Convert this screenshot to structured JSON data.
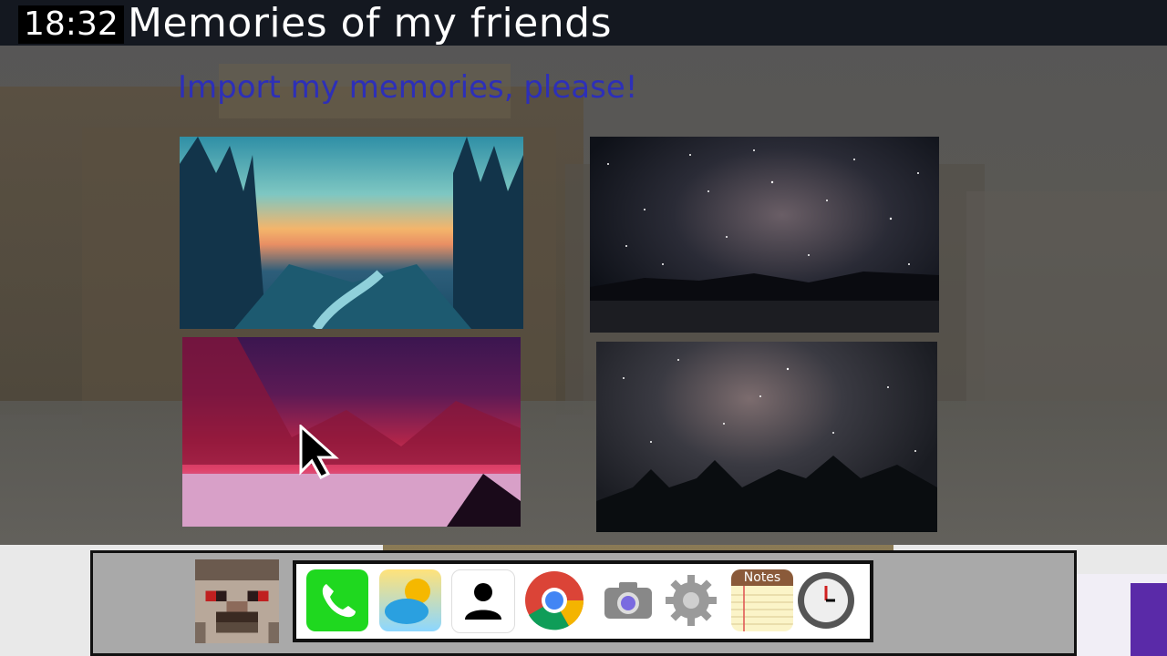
{
  "status_bar": {
    "time": "18:32"
  },
  "window": {
    "title": "Memories of my friends"
  },
  "main": {
    "subtitle": "Import my memories, please!",
    "photos": [
      {
        "name": "forest-sunset"
      },
      {
        "name": "milky-way-lake"
      },
      {
        "name": "pink-night-landscape"
      },
      {
        "name": "milky-way-forest"
      }
    ]
  },
  "dock": {
    "apps": [
      {
        "name": "phone",
        "icon": "phone-icon"
      },
      {
        "name": "weather",
        "icon": "weather-icon"
      },
      {
        "name": "contacts",
        "icon": "contacts-icon"
      },
      {
        "name": "chrome",
        "icon": "chrome-icon"
      },
      {
        "name": "camera",
        "icon": "camera-icon"
      },
      {
        "name": "settings",
        "icon": "gear-icon"
      },
      {
        "name": "notes",
        "icon": "notes-icon",
        "label": "Notes"
      },
      {
        "name": "clock",
        "icon": "clock-icon"
      }
    ]
  },
  "colors": {
    "subtitle": "#2d2fb8",
    "topbar": "#141820",
    "phone_green": "#1fd81f"
  }
}
